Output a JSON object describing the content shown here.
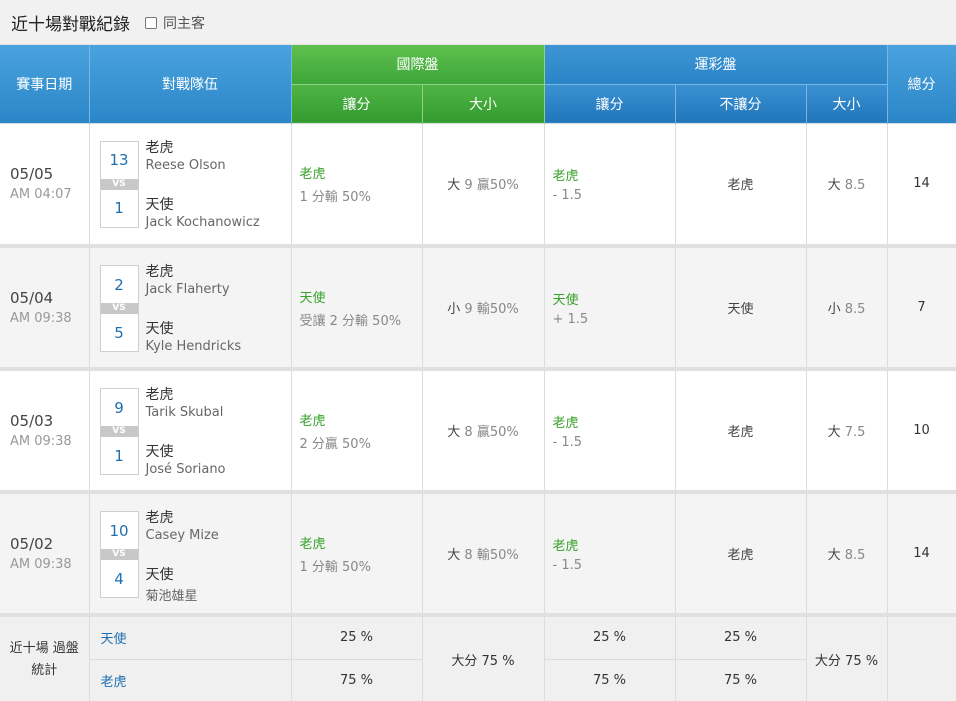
{
  "header": {
    "title": "近十場對戰紀錄",
    "same_host_label": "同主客"
  },
  "table": {
    "col_date": "賽事日期",
    "col_teams": "對戰隊伍",
    "col_total": "總分",
    "intl_group": "國際盤",
    "sports_group": "運彩盤",
    "intl_handicap": "讓分",
    "intl_ou": "大小",
    "sp_handicap": "讓分",
    "sp_moneyline": "不讓分",
    "sp_ou": "大小",
    "vs": "VS"
  },
  "games": [
    {
      "date": "05/05",
      "time": "AM 04:07",
      "home_score": "13",
      "away_score": "1",
      "home_team": "老虎",
      "home_pitcher": "Reese Olson",
      "away_team": "天使",
      "away_pitcher": "Jack Kochanowicz",
      "intl_hc_team": "老虎",
      "intl_hc_result": "1 分輸 50%",
      "intl_ou_side": "大",
      "intl_ou_result": "9  贏50%",
      "sp_hc_team": "老虎",
      "sp_hc_line": "- 1.5",
      "sp_ml": "老虎",
      "sp_ou_side": "大",
      "sp_ou_line": "8.5",
      "total": "14"
    },
    {
      "date": "05/04",
      "time": "AM 09:38",
      "home_score": "2",
      "away_score": "5",
      "home_team": "老虎",
      "home_pitcher": "Jack Flaherty",
      "away_team": "天使",
      "away_pitcher": "Kyle Hendricks",
      "intl_hc_team": "天使",
      "intl_hc_result": "受讓 2 分輸 50%",
      "intl_ou_side": "小",
      "intl_ou_result": "9  輸50%",
      "sp_hc_team": "天使",
      "sp_hc_line": "+ 1.5",
      "sp_ml": "天使",
      "sp_ou_side": "小",
      "sp_ou_line": "8.5",
      "total": "7"
    },
    {
      "date": "05/03",
      "time": "AM 09:38",
      "home_score": "9",
      "away_score": "1",
      "home_team": "老虎",
      "home_pitcher": "Tarik Skubal",
      "away_team": "天使",
      "away_pitcher": "José Soriano",
      "intl_hc_team": "老虎",
      "intl_hc_result": "2 分贏 50%",
      "intl_ou_side": "大",
      "intl_ou_result": "8  贏50%",
      "sp_hc_team": "老虎",
      "sp_hc_line": "- 1.5",
      "sp_ml": "老虎",
      "sp_ou_side": "大",
      "sp_ou_line": "7.5",
      "total": "10"
    },
    {
      "date": "05/02",
      "time": "AM 09:38",
      "home_score": "10",
      "away_score": "4",
      "home_team": "老虎",
      "home_pitcher": "Casey Mize",
      "away_team": "天使",
      "away_pitcher": "菊池雄星",
      "intl_hc_team": "老虎",
      "intl_hc_result": "1 分輸 50%",
      "intl_ou_side": "大",
      "intl_ou_result": "8  輸50%",
      "sp_hc_team": "老虎",
      "sp_hc_line": "- 1.5",
      "sp_ml": "老虎",
      "sp_ou_side": "大",
      "sp_ou_line": "8.5",
      "total": "14"
    }
  ],
  "footer": {
    "label_line1": "近十場 過盤",
    "label_line2": "統計",
    "team1": "天使",
    "team2": "老虎",
    "team1_intl_hc": "25 %",
    "team2_intl_hc": "75 %",
    "intl_ou": "大分 75 %",
    "team1_sp_hc": "25 %",
    "team2_sp_hc": "75 %",
    "team1_sp_ml": "25 %",
    "team2_sp_ml": "75 %",
    "sp_ou": "大分 75 %"
  },
  "colors": {
    "header_blue": "#2b86c8",
    "header_green": "#3ea63a",
    "team_green": "#37a22a",
    "score_blue": "#1f6fb0"
  }
}
